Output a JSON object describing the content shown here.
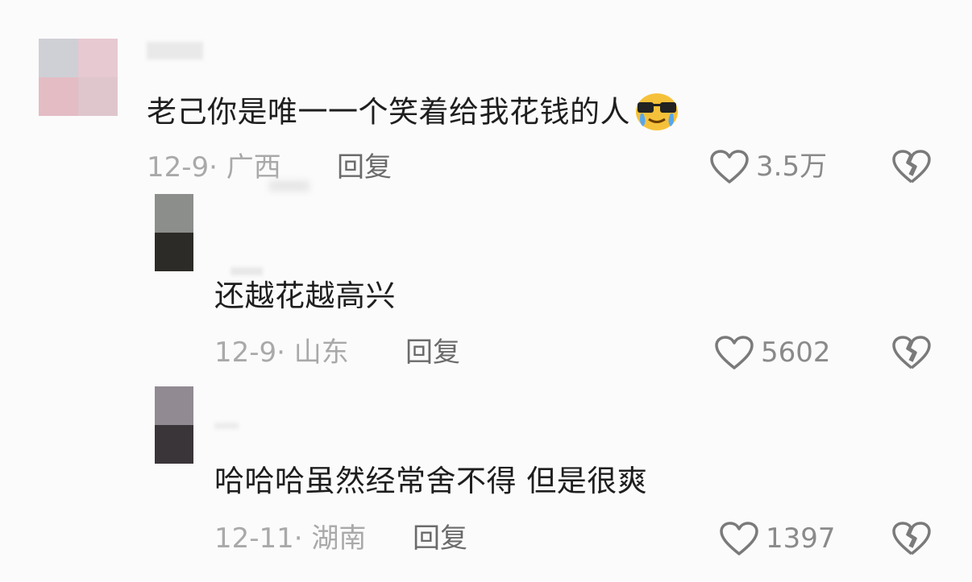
{
  "comments": [
    {
      "text": "老己你是唯一一个笑着给我花钱的人",
      "emoji": "😎",
      "date": "12-9",
      "location": "广西",
      "reply_label": "回复",
      "likes": "3.5万"
    }
  ],
  "replies": [
    {
      "text": "还越花越高兴",
      "date": "12-9",
      "location": "山东",
      "reply_label": "回复",
      "likes": "5602"
    },
    {
      "text": "哈哈哈虽然经常舍不得 但是很爽",
      "date": "12-11",
      "location": "湖南",
      "reply_label": "回复",
      "likes": "1397"
    }
  ],
  "separator": "·",
  "colors": {
    "icon": "#7a7a7a",
    "meta": "#a9a9a9",
    "reply": "#6b6b6b"
  }
}
